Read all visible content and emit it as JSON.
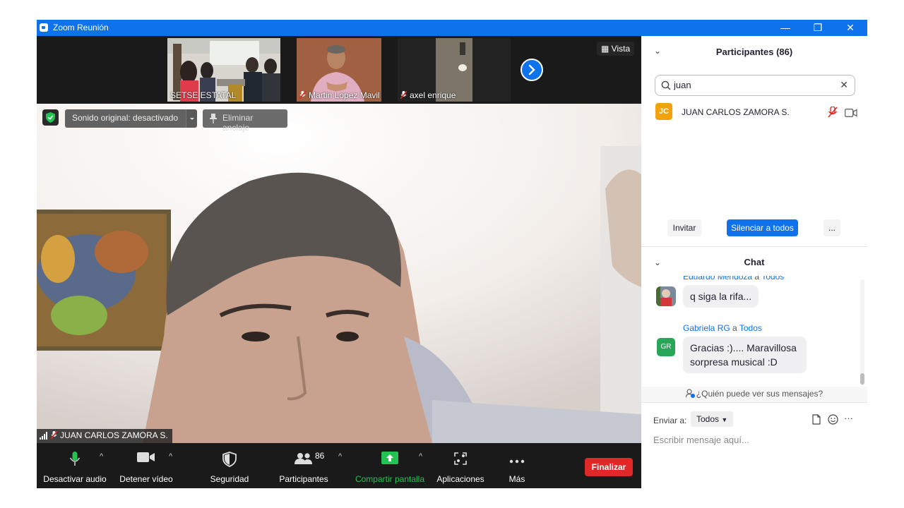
{
  "window": {
    "title": "Zoom Reunión",
    "controls": {
      "minimize": "—",
      "restore": "❐",
      "close": "✕"
    }
  },
  "colors": {
    "accent": "#0e72ed",
    "end": "#e02828",
    "share": "#23c252",
    "stage": "#1a1a1a"
  },
  "thumbnails": [
    {
      "name": "SETSE ESTATAL",
      "muted": false
    },
    {
      "name": "Martin Lopez Mavil",
      "muted": true
    },
    {
      "name": "axel enrique",
      "muted": true
    }
  ],
  "view_button": "Vista",
  "overlays": {
    "sound": "Sonido original: desactivado",
    "unpin": "Eliminar anclaje"
  },
  "main_speaker": {
    "name": "JUAN CARLOS ZAMORA S.",
    "muted": true
  },
  "toolbar": {
    "mute_audio": "Desactivar audio",
    "stop_video": "Detener vídeo",
    "security": "Seguridad",
    "participants": "Participantes",
    "participants_count": "86",
    "share_screen": "Compartir pantalla",
    "apps": "Aplicaciones",
    "more": "Más",
    "end": "Finalizar"
  },
  "participants_panel": {
    "title": "Participantes (86)",
    "search_value": "juan",
    "list": [
      {
        "initials": "JC",
        "name": "JUAN CARLOS ZAMORA S.",
        "muted": true
      }
    ],
    "invite": "Invitar",
    "mute_all": "Silenciar a todos",
    "more": "..."
  },
  "chat": {
    "title": "Chat",
    "messages": [
      {
        "sender": "Eduardo Mendoza",
        "to_word": "a",
        "to": "Todos",
        "text": "q siga la rifa..."
      },
      {
        "sender": "Gabriela RG",
        "to_word": "a",
        "to": "Todos",
        "initials": "GR",
        "text": "Gracias :).... Maravillosa sorpresa musical :D"
      }
    ],
    "who_can_see": "¿Quién puede ver sus mensajes?",
    "send_to_label": "Enviar a:",
    "send_to_value": "Todos",
    "input_placeholder": "Escribir mensaje aquí..."
  }
}
